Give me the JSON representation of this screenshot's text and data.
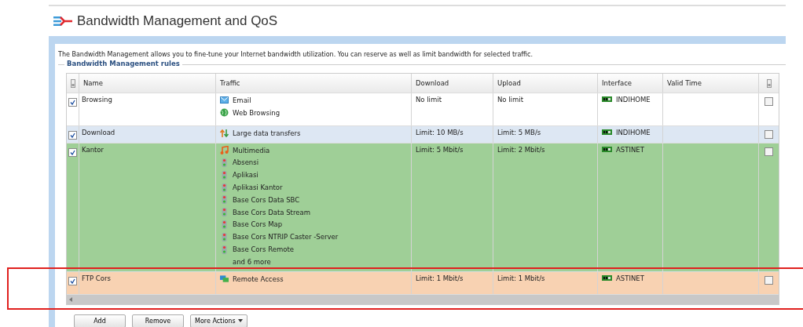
{
  "page": {
    "title": "Bandwidth Management and QoS",
    "description": "The Bandwidth Management allows you to fine-tune your Internet bandwidth utilization. You can reserve as well as limit bandwidth for selected traffic."
  },
  "rules": {
    "legend": "Bandwidth Management rules",
    "columns": [
      "Name",
      "Traffic",
      "Download",
      "Upload",
      "Interface",
      "Valid Time"
    ],
    "rows": [
      {
        "checked": true,
        "name": "Browsing",
        "color": "#ffffff",
        "traffic": [
          {
            "kind": "email",
            "label": "Email"
          },
          {
            "kind": "web",
            "label": "Web Browsing"
          }
        ],
        "download": "No limit",
        "upload": "No limit",
        "interface": "INDIHOME",
        "end_checked": false
      },
      {
        "checked": true,
        "name": "Download",
        "color": "#dde7f3",
        "traffic": [
          {
            "kind": "transfer",
            "label": "Large data transfers"
          }
        ],
        "download": "Limit: 10 MB/s",
        "upload": "Limit: 5 MB/s",
        "interface": "INDIHOME",
        "end_checked": false
      },
      {
        "checked": true,
        "name": "Kantor",
        "color": "#9fcf97",
        "traffic": [
          {
            "kind": "multimedia",
            "label": "Multimedia"
          },
          {
            "kind": "app",
            "label": "Absensi"
          },
          {
            "kind": "app",
            "label": "Aplikasi"
          },
          {
            "kind": "app",
            "label": "Aplikasi Kantor"
          },
          {
            "kind": "app",
            "label": "Base Cors Data SBC"
          },
          {
            "kind": "app",
            "label": "Base Cors Data Stream"
          },
          {
            "kind": "app",
            "label": "Base Cors Map"
          },
          {
            "kind": "app",
            "label": "Base Cors NTRIP Caster -Server"
          },
          {
            "kind": "app",
            "label": "Base Cors Remote"
          },
          {
            "kind": "more",
            "label": "and 6 more"
          }
        ],
        "download": "Limit: 5 Mbit/s",
        "upload": "Limit: 2 Mbit/s",
        "interface": "ASTINET",
        "end_checked": false
      },
      {
        "checked": true,
        "name": "FTP Cors",
        "color": "#f8d2b2",
        "traffic": [
          {
            "kind": "remote",
            "label": "Remote Access"
          }
        ],
        "download": "Limit: 1 Mbit/s",
        "upload": "Limit: 1 Mbit/s",
        "interface": "ASTINET",
        "end_checked": false
      }
    ]
  },
  "buttons": [
    {
      "kind": "plain",
      "label": "Add"
    },
    {
      "kind": "plain",
      "label": "Remove"
    },
    {
      "kind": "menu",
      "label": "More Actions"
    }
  ]
}
